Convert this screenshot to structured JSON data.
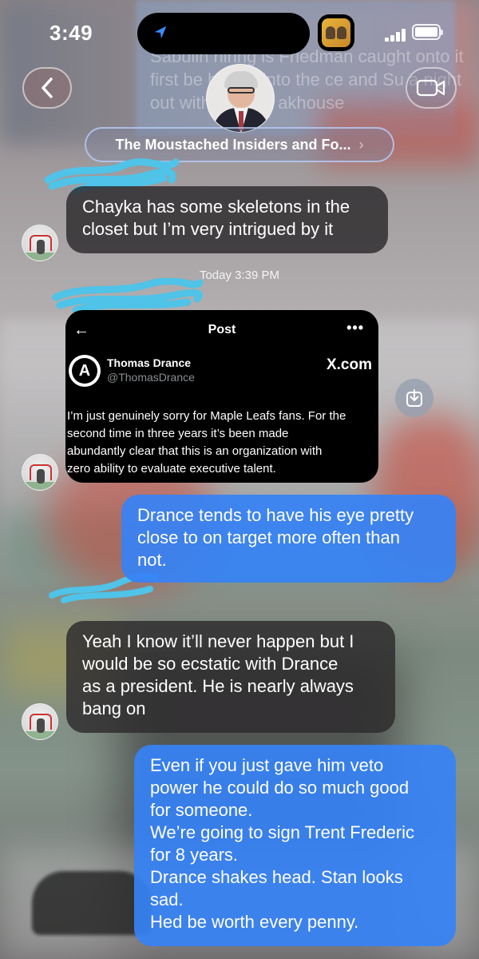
{
  "status_bar": {
    "time": "3:49"
  },
  "header": {
    "back_icon": "chevron-left-icon",
    "video_icon": "video-camera-icon",
    "group_name": "The Moustached Insiders and Fo...",
    "group_name_chevron": "›",
    "background_text": "Sabulin\nhiring is Friedman caught onto it\nfirst be       he ran into the ce\nand Su         a night out with\nson to t         akhouse"
  },
  "messages": [
    {
      "type": "incoming",
      "text": "Chayka has some skeletons in the\ncloset but I’m very intrigued by it"
    },
    {
      "type": "timestamp",
      "text": "Today 3:39 PM"
    },
    {
      "type": "incoming_tweet",
      "tweet": {
        "header_title": "Post",
        "back_icon": "arrow-left-icon",
        "more_label": "•••",
        "logo_letter": "A",
        "author_name": "Thomas Drance",
        "author_handle": "@ThomasDrance",
        "source_label": "X.com",
        "body": "I’m just genuinely sorry for Maple Leafs fans. For the\nsecond time in three years it’s been made\nabundantly clear that this is an organization with\nzero ability to evaluate executive talent."
      }
    },
    {
      "type": "outgoing",
      "text": "Drance tends to have his eye pretty\nclose to on target more often than\nnot."
    },
    {
      "type": "incoming",
      "text": "Yeah I know it’ll never happen but I\nwould be so ecstatic with Drance\nas a president. He is nearly always\nbang on"
    },
    {
      "type": "outgoing",
      "text": "Even if you just gave him veto\npower he could do so much good\nfor someone.\nWe’re going to sign Trent Frederic\nfor 8 years.\nDrance shakes head. Stan looks\nsad.\nHed be worth every penny."
    }
  ],
  "colors": {
    "incoming_bubble": "#2e2c2e",
    "outgoing_bubble": "#3682f6",
    "redaction_scribble": "#4fc3e8"
  }
}
